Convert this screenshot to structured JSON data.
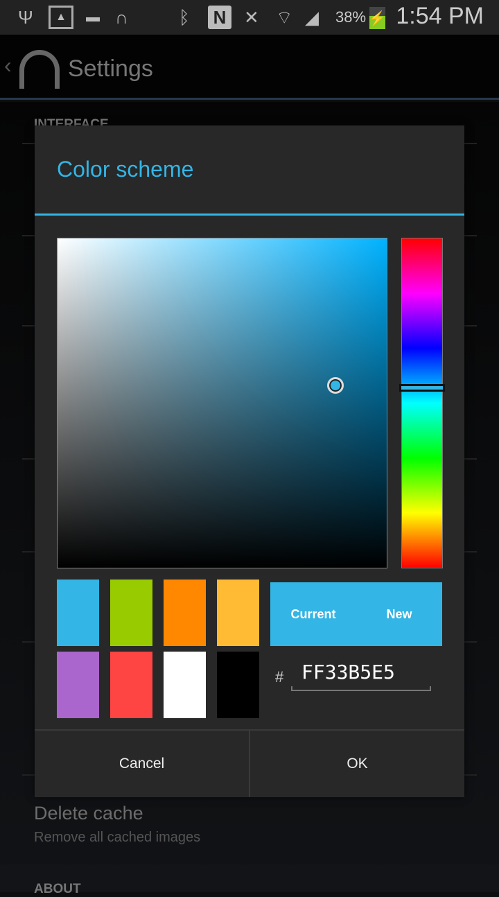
{
  "status_bar": {
    "icons": [
      "usb-icon",
      "image-icon",
      "sd-card-icon",
      "headphones-icon",
      "bluetooth-icon",
      "nfc-icon",
      "mute-icon",
      "wifi-icon",
      "signal-icon",
      "battery-charging-icon"
    ],
    "battery": "38%",
    "time": "1:54 PM"
  },
  "action_bar": {
    "title": "Settings",
    "icon": "headphones-app-icon"
  },
  "background": {
    "section_header": "INTERFACE",
    "delete_cache_title": "Delete cache",
    "delete_cache_summary": "Remove all cached images",
    "bottom_header": "ABOUT"
  },
  "dialog": {
    "title": "Color scheme",
    "accent": "#33B5E5",
    "swatches": [
      "#33B5E5",
      "#99CC00",
      "#FF8800",
      "#FFBB33",
      "#AA66CC",
      "#FF4444",
      "#FFFFFF",
      "#000000"
    ],
    "preview": {
      "current_label": "Current",
      "new_label": "New"
    },
    "hex_prefix": "#",
    "hex_value": "FF33B5E5",
    "cancel": "Cancel",
    "ok": "OK"
  }
}
